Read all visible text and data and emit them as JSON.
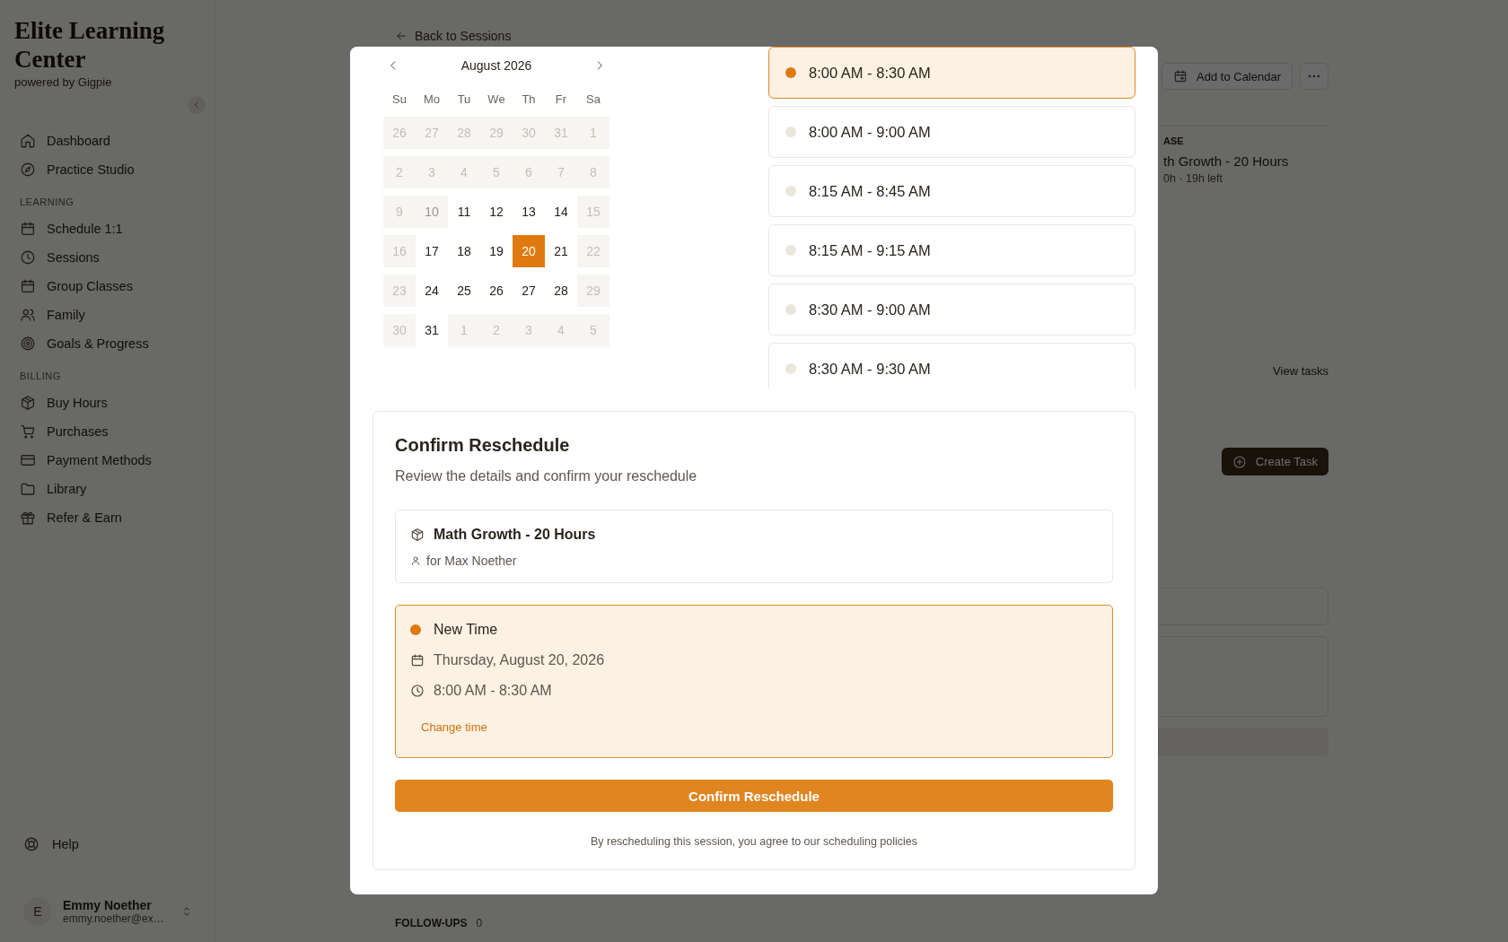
{
  "sidebar": {
    "title": "Elite Learning Center",
    "subtitle": "powered by Gigpie",
    "groups": [
      {
        "items": [
          {
            "label": "Dashboard"
          },
          {
            "label": "Practice Studio"
          }
        ]
      },
      {
        "heading": "LEARNING",
        "items": [
          {
            "label": "Schedule 1:1"
          },
          {
            "label": "Sessions"
          },
          {
            "label": "Group Classes"
          },
          {
            "label": "Family"
          },
          {
            "label": "Goals & Progress"
          }
        ]
      },
      {
        "heading": "BILLING",
        "items": [
          {
            "label": "Buy Hours"
          },
          {
            "label": "Purchases"
          },
          {
            "label": "Payment Methods"
          },
          {
            "label": "Library"
          },
          {
            "label": "Refer & Earn"
          }
        ]
      }
    ],
    "help": "Help",
    "user": {
      "initial": "E",
      "name": "Emmy Noether",
      "email": "emmy.noether@ex…"
    }
  },
  "main": {
    "back_link": "Back to Sessions",
    "add_to_calendar": "Add to Calendar",
    "purchase": {
      "label": "ASE",
      "title": "th Growth - 20 Hours",
      "meta": "0h · 19h left"
    },
    "tasks_link": "View tasks",
    "create_task": "Create Task",
    "follow_ups": {
      "label": "FOLLOW-UPS",
      "count": "0"
    }
  },
  "modal": {
    "calendar": {
      "month": "August 2026",
      "weekdays": [
        "Su",
        "Mo",
        "Tu",
        "We",
        "Th",
        "Fr",
        "Sa"
      ],
      "days": [
        {
          "label": "26",
          "kind": "muted",
          "selected": false
        },
        {
          "label": "27",
          "kind": "muted",
          "selected": false
        },
        {
          "label": "28",
          "kind": "muted",
          "selected": false
        },
        {
          "label": "29",
          "kind": "muted",
          "selected": false
        },
        {
          "label": "30",
          "kind": "muted",
          "selected": false
        },
        {
          "label": "31",
          "kind": "muted",
          "selected": false
        },
        {
          "label": "1",
          "kind": "muted",
          "selected": false
        },
        {
          "label": "2",
          "kind": "muted",
          "selected": false
        },
        {
          "label": "3",
          "kind": "muted",
          "selected": false
        },
        {
          "label": "4",
          "kind": "muted",
          "selected": false
        },
        {
          "label": "5",
          "kind": "muted",
          "selected": false
        },
        {
          "label": "6",
          "kind": "muted",
          "selected": false
        },
        {
          "label": "7",
          "kind": "muted",
          "selected": false
        },
        {
          "label": "8",
          "kind": "muted",
          "selected": false
        },
        {
          "label": "9",
          "kind": "muted",
          "selected": false
        },
        {
          "label": "10",
          "kind": "dim",
          "selected": false
        },
        {
          "label": "11",
          "kind": "open",
          "selected": false
        },
        {
          "label": "12",
          "kind": "open",
          "selected": false
        },
        {
          "label": "13",
          "kind": "open",
          "selected": false
        },
        {
          "label": "14",
          "kind": "open",
          "selected": false
        },
        {
          "label": "15",
          "kind": "muted",
          "selected": false
        },
        {
          "label": "16",
          "kind": "muted",
          "selected": false
        },
        {
          "label": "17",
          "kind": "open",
          "selected": false
        },
        {
          "label": "18",
          "kind": "open",
          "selected": false
        },
        {
          "label": "19",
          "kind": "open",
          "selected": false
        },
        {
          "label": "20",
          "kind": "open",
          "selected": true
        },
        {
          "label": "21",
          "kind": "open",
          "selected": false
        },
        {
          "label": "22",
          "kind": "muted",
          "selected": false
        },
        {
          "label": "23",
          "kind": "muted",
          "selected": false
        },
        {
          "label": "24",
          "kind": "open",
          "selected": false
        },
        {
          "label": "25",
          "kind": "open",
          "selected": false
        },
        {
          "label": "26",
          "kind": "open",
          "selected": false
        },
        {
          "label": "27",
          "kind": "open",
          "selected": false
        },
        {
          "label": "28",
          "kind": "open",
          "selected": false
        },
        {
          "label": "29",
          "kind": "muted",
          "selected": false
        },
        {
          "label": "30",
          "kind": "muted",
          "selected": false
        },
        {
          "label": "31",
          "kind": "open",
          "selected": false
        },
        {
          "label": "1",
          "kind": "muted",
          "selected": false
        },
        {
          "label": "2",
          "kind": "muted",
          "selected": false
        },
        {
          "label": "3",
          "kind": "muted",
          "selected": false
        },
        {
          "label": "4",
          "kind": "muted",
          "selected": false
        },
        {
          "label": "5",
          "kind": "muted",
          "selected": false
        }
      ]
    },
    "slots": [
      {
        "label": "8:00 AM - 8:30 AM",
        "selected": true
      },
      {
        "label": "8:00 AM - 9:00 AM",
        "selected": false
      },
      {
        "label": "8:15 AM - 8:45 AM",
        "selected": false
      },
      {
        "label": "8:15 AM - 9:15 AM",
        "selected": false
      },
      {
        "label": "8:30 AM - 9:00 AM",
        "selected": false
      },
      {
        "label": "8:30 AM - 9:30 AM",
        "selected": false
      }
    ],
    "confirm": {
      "title": "Confirm Reschedule",
      "subtitle": "Review the details and confirm your reschedule",
      "package": {
        "name": "Math Growth - 20 Hours",
        "student": "for Max Noether"
      },
      "new_time": {
        "heading": "New Time",
        "date": "Thursday, August 20, 2026",
        "time": "8:00 AM - 8:30 AM",
        "change_link": "Change time"
      },
      "button": "Confirm Reschedule",
      "note": "By rescheduling this session, you agree to our scheduling policies"
    }
  }
}
